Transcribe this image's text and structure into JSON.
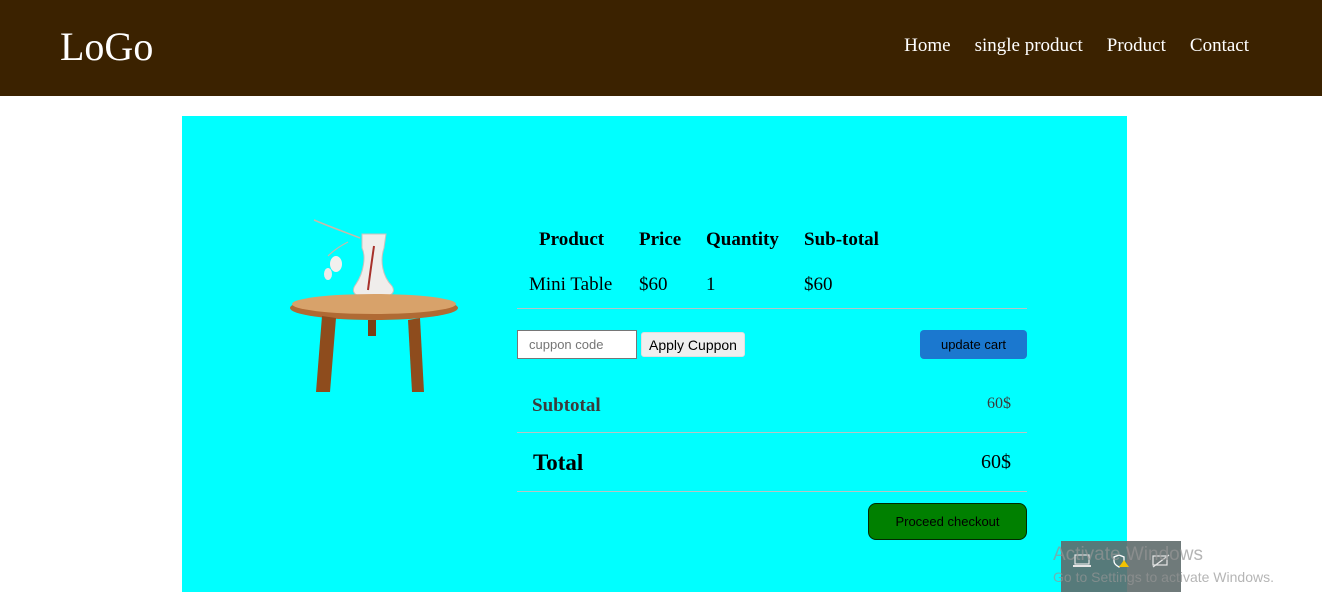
{
  "header": {
    "logo": "LoGo",
    "nav": [
      "Home",
      "single product",
      "Product",
      "Contact"
    ]
  },
  "cart": {
    "headers": {
      "product": "Product",
      "price": "Price",
      "quantity": "Quantity",
      "subtotal": "Sub-total"
    },
    "item": {
      "product": "Mini Table",
      "price": "$60",
      "quantity": "1",
      "subtotal": "$60"
    },
    "image_icon": "side-table-with-vase"
  },
  "coupon": {
    "placeholder": "cuppon code",
    "apply_label": "Apply Cuppon"
  },
  "update_label": "update cart",
  "totals": {
    "subtotal_label": "Subtotal",
    "subtotal_value": "60$",
    "total_label": "Total",
    "total_value": "60$"
  },
  "checkout_label": "Proceed checkout",
  "watermark": {
    "title": "Activate Windows",
    "subtitle": "Go to Settings to activate Windows."
  },
  "colors": {
    "navbar": "#3b2200",
    "panel": "#00ffff",
    "update_button": "#1b78cf",
    "checkout_button": "#008000"
  }
}
